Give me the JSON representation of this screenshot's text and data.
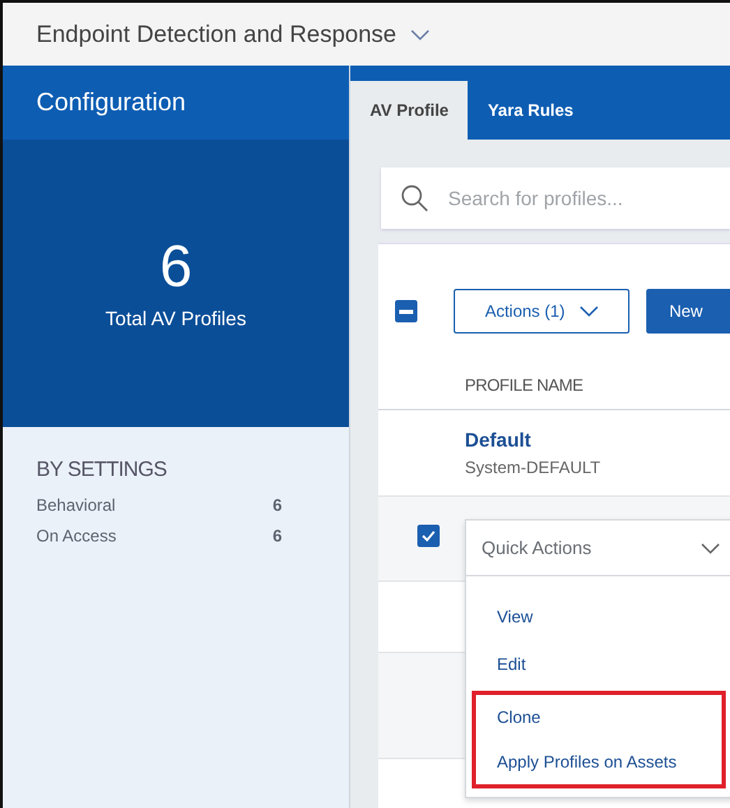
{
  "header": {
    "title": "Endpoint Detection and Response"
  },
  "sidebar": {
    "title": "Configuration",
    "total": {
      "value": "6",
      "label": "Total AV Profiles"
    },
    "section_title": "BY SETTINGS",
    "settings": [
      {
        "label": "Behavioral",
        "count": "6"
      },
      {
        "label": "On Access",
        "count": "6"
      }
    ]
  },
  "tabs": [
    {
      "label": "AV Profile",
      "selected": true
    },
    {
      "label": "Yara Rules",
      "selected": false
    }
  ],
  "search": {
    "placeholder": "Search for profiles..."
  },
  "toolbar": {
    "select_all": {
      "indeterminate": true
    },
    "actions_label": "Actions (1)",
    "new_button": "New"
  },
  "table": {
    "columns": [
      "PROFILE NAME"
    ],
    "rows": [
      {
        "name": "Default",
        "subtitle": "System-DEFAULT",
        "checked": false
      },
      {
        "checked": true
      }
    ]
  },
  "quick_actions": {
    "label": "Quick Actions",
    "items": [
      {
        "label": "View",
        "highlighted": false
      },
      {
        "label": "Edit",
        "highlighted": false
      },
      {
        "label": "Clone",
        "highlighted": true
      },
      {
        "label": "Apply Profiles on Assets",
        "highlighted": true
      }
    ]
  }
}
